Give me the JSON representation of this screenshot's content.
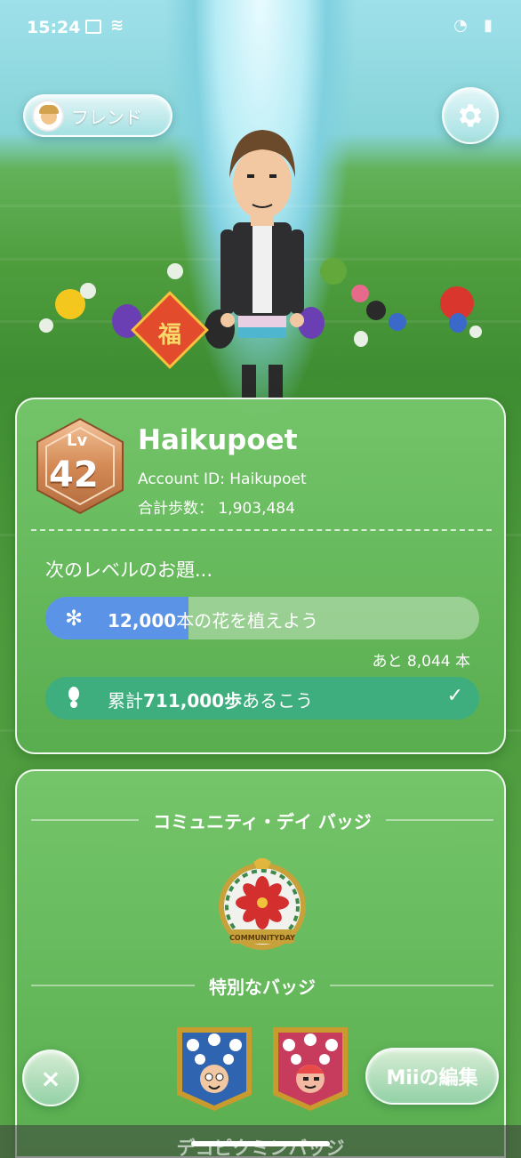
{
  "status_bar": {
    "time": "15:24"
  },
  "header": {
    "friend_label": "フレンド"
  },
  "profile": {
    "level_prefix": "Lv",
    "level": "42",
    "name": "Haikupoet",
    "account_id": "Account ID: Haikupoet",
    "total_steps": "合計歩数： 1,903,484",
    "next_level_title": "次のレベルのお題...",
    "tasks": [
      {
        "bold": "12,000",
        "text": "本の花を植えよう",
        "progress": 0.33,
        "remaining": "あと 8,044 本",
        "icon": "flower-icon"
      },
      {
        "prefix": "累計",
        "bold": "711,000歩",
        "text": "あるこう",
        "completed": true,
        "icon": "footprint-icon"
      }
    ]
  },
  "badges": {
    "community_heading": "コミュニティ・デイ バッジ",
    "community_badge_text": "COMMUNITYDAY",
    "special_heading": "特別なバッジ",
    "next_heading": "デコピクミンバッジ"
  },
  "buttons": {
    "close": "×",
    "edit_mii": "Miiの編集"
  },
  "colors": {
    "accent_blue": "#5b93e6",
    "complete_green": "#3fae7f",
    "card_green": "#6fbf5e"
  }
}
